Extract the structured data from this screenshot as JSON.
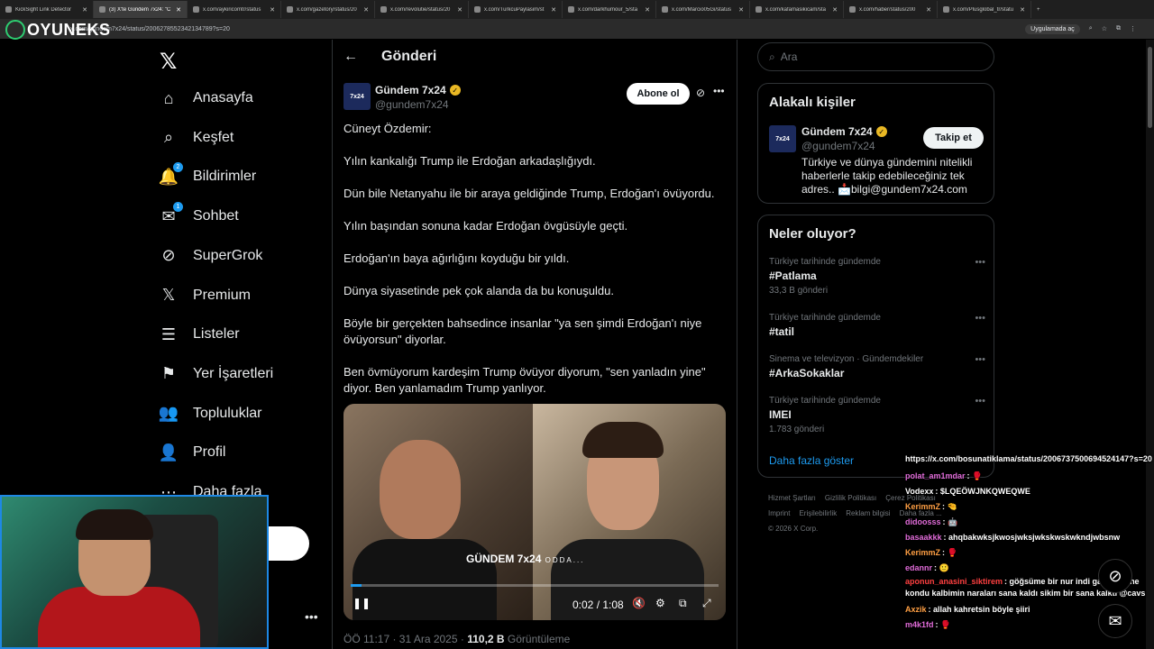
{
  "browser": {
    "tabs": [
      {
        "label": "KickSight Link Detector"
      },
      {
        "label": "(3) X'te Gündem 7x24: \"C"
      },
      {
        "label": "x.com/aykiricomtr/status"
      },
      {
        "label": "x.com/gazetory/status/20"
      },
      {
        "label": "x.com/revolutie/status/20"
      },
      {
        "label": "x.com/TurkcuPaylasim/st"
      },
      {
        "label": "x.com/darkhumour_5/sta"
      },
      {
        "label": "x.com/Marcio05Gi/status"
      },
      {
        "label": "x.com/kafamasikicam/sta"
      },
      {
        "label": "x.com/haber/status/200"
      },
      {
        "label": "x.com/Plusglobal_tr/statu"
      }
    ],
    "url": "x.com/gundem7x24/status/2006278552342134789?s=20",
    "app_pill": "Uygulamada aç"
  },
  "stream_logo": "OYUNEKS",
  "nav": {
    "items": [
      {
        "label": "Anasayfa",
        "icon": "⌂"
      },
      {
        "label": "Keşfet",
        "icon": "⌕"
      },
      {
        "label": "Bildirimler",
        "icon": "🔔",
        "badge": "2"
      },
      {
        "label": "Sohbet",
        "icon": "✉",
        "badge": "1"
      },
      {
        "label": "SuperGrok",
        "icon": "⊘"
      },
      {
        "label": "Premium",
        "icon": "𝕏"
      },
      {
        "label": "Listeler",
        "icon": "☰"
      },
      {
        "label": "Yer İşaretleri",
        "icon": "⚑"
      },
      {
        "label": "Topluluklar",
        "icon": "👥"
      },
      {
        "label": "Profil",
        "icon": "👤"
      },
      {
        "label": "Daha fazla",
        "icon": "⋯"
      }
    ],
    "post_button": "a"
  },
  "post": {
    "header_title": "Gönderi",
    "author_name": "Gündem 7x24",
    "author_handle": "@gundem7x24",
    "avatar_text": "7x24",
    "subscribe_label": "Abone ol",
    "paragraphs": [
      "Cüneyt Özdemir:",
      "Yılın kankalığı Trump ile Erdoğan arkadaşlığıydı.",
      "Dün bile Netanyahu ile bir araya geldiğinde Trump, Erdoğan'ı övüyordu.",
      "Yılın başından sonuna kadar Erdoğan övgüsüyle geçti.",
      "Erdoğan'ın baya ağırlığını koyduğu bir yıldı.",
      "Dünya siyasetinde pek çok alanda da bu konuşuldu.",
      "Böyle bir gerçekten bahsedince insanlar \"ya sen şimdi Erdoğan'ı niye övüyorsun\" diyorlar.",
      "Ben övmüyorum kardeşim Trump övüyor diyorum, \"sen yanladın yine\" diyor. Ben yanlamadım Trump yanlıyor."
    ],
    "video": {
      "time": "0:02 / 1:08",
      "watermark_brand": "GÜNDEM 7x24",
      "watermark_suffix": "ODDA...",
      "progress_fraction": 0.03
    },
    "meta_time": "ÖÖ 11:17 · 31 Ara 2025 · ",
    "meta_views": "110,2 B",
    "meta_views_label": " Görüntüleme"
  },
  "right": {
    "search_placeholder": "Ara",
    "related_title": "Alakalı kişiler",
    "related": {
      "name": "Gündem 7x24",
      "handle": "@gundem7x24",
      "follow_label": "Takip et",
      "bio": "Türkiye ve dünya gündemini nitelikli haberlerle takip edebileceğiniz tek adres.. 📩bilgi@gundem7x24.com"
    },
    "trends_title": "Neler oluyor?",
    "trends": [
      {
        "context": "Türkiye tarihinde gündemde",
        "name": "#Patlama",
        "count": "33,3 B gönderi"
      },
      {
        "context": "Türkiye tarihinde gündemde",
        "name": "#tatil",
        "count": ""
      },
      {
        "context": "Sinema ve televizyon · Gündemdekiler",
        "name": "#ArkaSokaklar",
        "count": ""
      },
      {
        "context": "Türkiye tarihinde gündemde",
        "name": "IMEI",
        "count": "1.783 gönderi"
      }
    ],
    "show_more": "Daha fazla göster",
    "footer": [
      "Hizmet Şartları",
      "Gizlilik Politikası",
      "Çerez Politikası",
      "Imprint",
      "Erişilebilirlik",
      "Reklam bilgisi",
      "Daha fazla ...",
      "© 2026 X Corp."
    ]
  },
  "chat": {
    "url_line": "https://x.com/bosunatiklama/status/2006737500694524147?s=20",
    "messages": [
      {
        "user": "polat_am1mdar",
        "text": ": 🥊",
        "color": "#e06bd8"
      },
      {
        "user": "Vodexx",
        "text": ": $LQEÖWJNKQWEQWE",
        "color": "#ffffff"
      },
      {
        "user": "KerimmZ",
        "text": ": 🤏",
        "color": "#ff9f43"
      },
      {
        "user": "didoosss",
        "text": ": 🤖",
        "color": "#e06bd8"
      },
      {
        "user": "basaakkk",
        "text": ": ahqbakwksjkwosjwksjwkskwskwkndjwbsnw",
        "color": "#e06bd8"
      },
      {
        "user": "KerimmZ",
        "text": ": 🥊",
        "color": "#ff9f43"
      },
      {
        "user": "edannr",
        "text": ": 🙂",
        "color": "#e06bd8"
      },
      {
        "user": "aponun_anasini_siktirem",
        "text": ": göğsüme bir nur indi gamzelerine kondu kalbimin naraları sana kaldı sikim bir sana kalktı @cavs",
        "color": "#ff4040",
        "wrap": true
      },
      {
        "user": "Axzik",
        "text": ": allah kahretsin böyle şiiri",
        "color": "#ff9f43"
      },
      {
        "user": "m4k1fd",
        "text": ": 🥊",
        "color": "#e06bd8"
      }
    ]
  }
}
